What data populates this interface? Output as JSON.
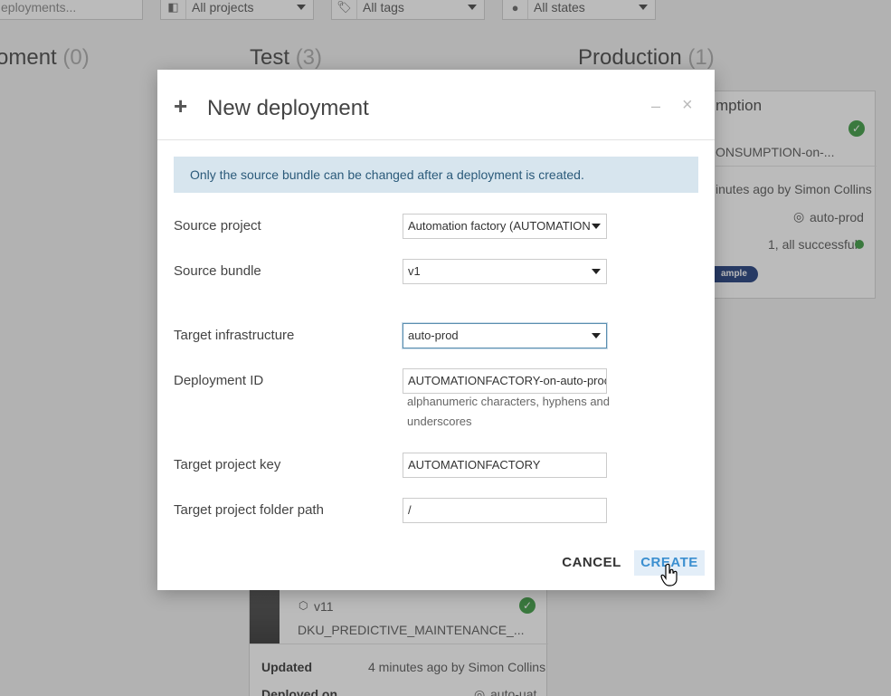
{
  "filters": {
    "search_placeholder": "eployments...",
    "projects": "All projects",
    "tags": "All tags",
    "states": "All states"
  },
  "columns": {
    "development": {
      "title": "oment",
      "count": "(0)"
    },
    "test": {
      "title": "Test",
      "count": "(3)"
    },
    "production": {
      "title": "Production",
      "count": "(1)"
    }
  },
  "prod_card": {
    "title": "mption",
    "deployment_id": "ONSUMPTION-on-...",
    "updated": "inutes ago by Simon Collins",
    "infra": "auto-prod",
    "status": "1, all successful",
    "tag": "ample"
  },
  "test_card": {
    "bundle": "v11",
    "deployment_id": "DKU_PREDICTIVE_MAINTENANCE_...",
    "updated_label": "Updated",
    "updated_value": "4 minutes ago by Simon Collins",
    "deployed_label": "Deployed on",
    "deployed_value": "auto-uat"
  },
  "modal": {
    "title": "New deployment",
    "minimize_glyph": "–",
    "close_glyph": "×",
    "info": "Only the source bundle can be changed after a deployment is created.",
    "fields": {
      "source_project": {
        "label": "Source project",
        "value": "Automation factory (AUTOMATION"
      },
      "source_bundle": {
        "label": "Source bundle",
        "value": "v1"
      },
      "target_infrastructure": {
        "label": "Target infrastructure",
        "value": "auto-prod"
      },
      "deployment_id": {
        "label": "Deployment ID",
        "value": "AUTOMATIONFACTORY-on-auto-proc",
        "help": "alphanumeric characters, hyphens and underscores"
      },
      "target_project_key": {
        "label": "Target project key",
        "value": "AUTOMATIONFACTORY"
      },
      "target_folder_path": {
        "label": "Target project folder path",
        "value": "/"
      }
    },
    "cancel_label": "CANCEL",
    "create_label": "CREATE"
  },
  "colors": {
    "accent": "#3b8fd0",
    "success": "#3a9a3f",
    "info_bg": "#d7e5ee",
    "tag_bg": "#1d3a7a"
  }
}
